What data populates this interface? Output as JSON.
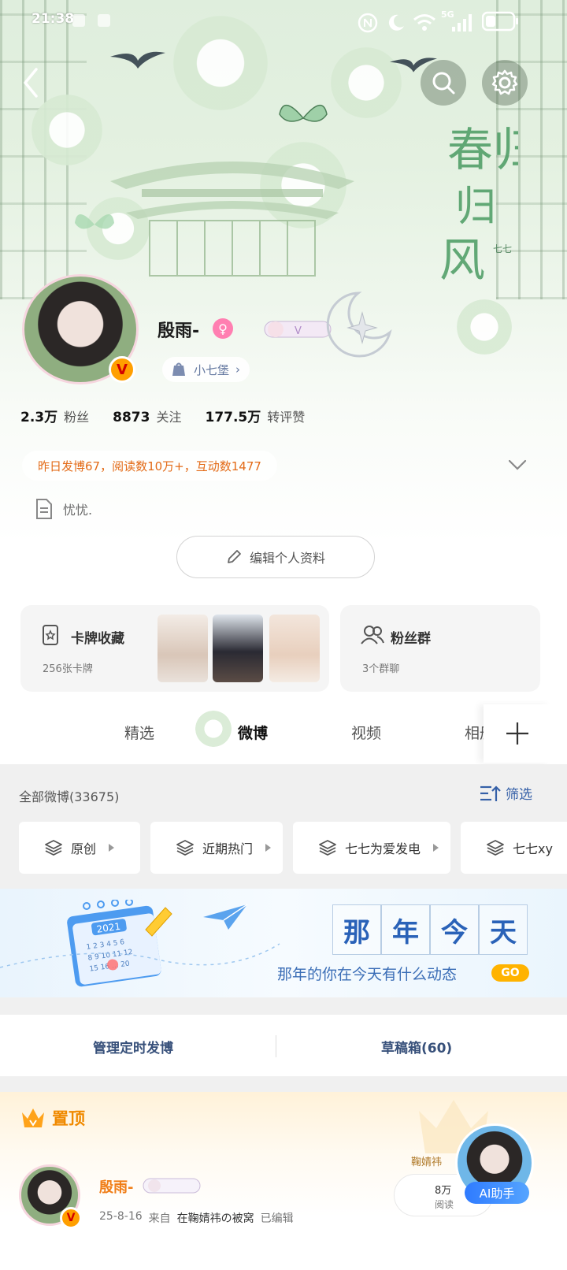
{
  "status_bar": {
    "time": "21:38",
    "network": "5G"
  },
  "header": {
    "back_icon": "chevron-left-icon",
    "search_icon": "search-icon",
    "settings_icon": "gear-icon",
    "art_text": "春归风",
    "art_sub": "七七"
  },
  "profile": {
    "name": "殷雨-",
    "gender_icon": "female-icon",
    "vip_badge": "V",
    "verified_badge": "V",
    "castle_label": "小七堡",
    "stats": [
      {
        "num": "2.3万",
        "label": "粉丝"
      },
      {
        "num": "8873",
        "label": "关注"
      },
      {
        "num": "177.5万",
        "label": "转评赞"
      }
    ],
    "activity": "昨日发博67，阅读数10万+，互动数1477",
    "bio": "忧忧.",
    "edit_button": "编辑个人资料"
  },
  "cards": {
    "collection_title": "卡牌收藏",
    "collection_sub": "256张卡牌",
    "fans_title": "粉丝群",
    "fans_sub": "3个群聊"
  },
  "tabs": {
    "items": [
      "精选",
      "微博",
      "视频",
      "相册"
    ],
    "active": "微博"
  },
  "feed": {
    "all_posts": "全部微博(33675)",
    "filter": "筛选",
    "chips": [
      "原创",
      "近期热门",
      "七七为爱发电",
      "七七xy"
    ]
  },
  "banner": {
    "chars": [
      "那",
      "年",
      "今",
      "天"
    ],
    "year": "2021",
    "subtitle": "那年的你在今天有什么动态",
    "go": "GO"
  },
  "manage": {
    "scheduled": "管理定时发博",
    "drafts": "草稿箱(60)"
  },
  "pinned": {
    "title": "置顶",
    "post_name": "殷雨-",
    "post_date": "25-8-16",
    "post_from_label": "来自",
    "post_source": "在鞠婧祎の被窝",
    "post_edited": "已编辑",
    "read_count": "8万",
    "read_label": "阅读",
    "mini_label": "鞠婧祎",
    "ai_button": "AI助手"
  },
  "colors": {
    "accent_orange": "#f08a00",
    "link_blue": "#3560a8",
    "ai_blue": "#2f7bff",
    "activity_orange": "#e36a16"
  }
}
